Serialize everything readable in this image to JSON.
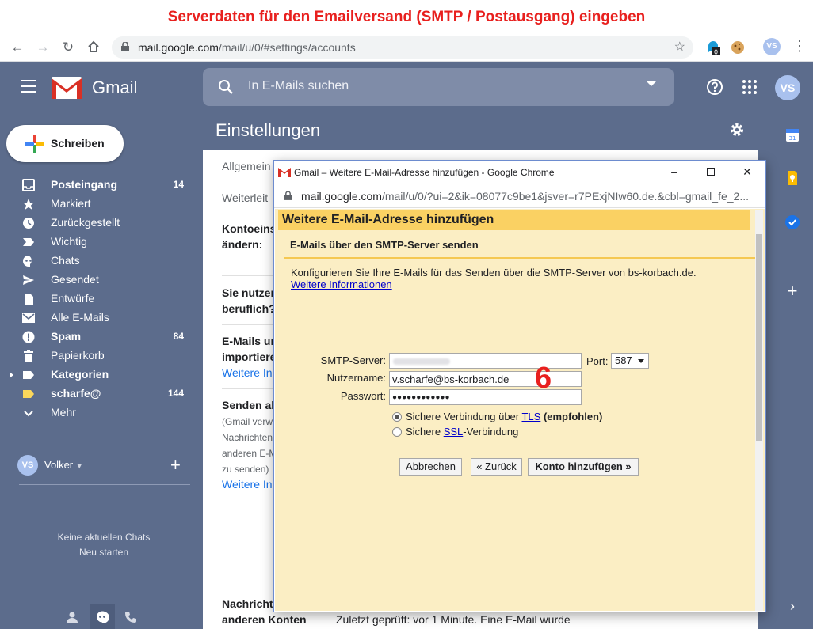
{
  "banner": {
    "text": "Serverdaten für den Emailversand (SMTP / Postausgang) eingeben"
  },
  "browser": {
    "url_host": "mail.google.com",
    "url_path": "/mail/u/0/#settings/accounts",
    "profile_initials": "VS",
    "extension_badge": "0"
  },
  "gmail": {
    "brand": "Gmail",
    "search_placeholder": "In E-Mails suchen",
    "avatar_initials": "VS",
    "compose_label": "Schreiben"
  },
  "sidebar": {
    "items": [
      {
        "label": "Posteingang",
        "count": "14",
        "bold": true,
        "icon": "inbox-icon"
      },
      {
        "label": "Markiert",
        "count": "",
        "bold": false,
        "icon": "star-icon"
      },
      {
        "label": "Zurückgestellt",
        "count": "",
        "bold": false,
        "icon": "clock-icon"
      },
      {
        "label": "Wichtig",
        "count": "",
        "bold": false,
        "icon": "important-icon"
      },
      {
        "label": "Chats",
        "count": "",
        "bold": false,
        "icon": "chat-icon"
      },
      {
        "label": "Gesendet",
        "count": "",
        "bold": false,
        "icon": "send-icon"
      },
      {
        "label": "Entwürfe",
        "count": "",
        "bold": false,
        "icon": "draft-icon"
      },
      {
        "label": "Alle E-Mails",
        "count": "",
        "bold": false,
        "icon": "mail-icon"
      },
      {
        "label": "Spam",
        "count": "84",
        "bold": true,
        "icon": "spam-icon"
      },
      {
        "label": "Papierkorb",
        "count": "",
        "bold": false,
        "icon": "trash-icon"
      },
      {
        "label": "Kategorien",
        "count": "",
        "bold": true,
        "icon": "label-icon"
      },
      {
        "label": "scharfe@",
        "count": "144",
        "bold": true,
        "icon": "label-yellow-icon"
      },
      {
        "label": "Mehr",
        "count": "",
        "bold": false,
        "icon": "chevron-down-icon"
      }
    ],
    "hangouts_user": "Volker",
    "hangouts_initials": "VS",
    "no_chats": "Keine aktuellen Chats",
    "new_chat": "Neu starten"
  },
  "settings": {
    "title": "Einstellungen",
    "tab_general": "Allgemein",
    "tab_forwarding": "Weiterleit",
    "account_change_1": "Kontoeins",
    "account_change_2": "ändern:",
    "business_1": "Sie nutzer",
    "business_2": "beruflich?",
    "import_1": "E-Mails ur",
    "import_2": "importiere",
    "more_info_1": "Weitere In",
    "send_as": "Senden als",
    "send_as_1": "(Gmail verw",
    "send_as_2": "Nachrichten",
    "send_as_3": "anderen E-M",
    "send_as_4": "zu senden)",
    "more_info_2": "Weitere In",
    "messages_1": "Nachrichte",
    "messages_2": "anderen Konten",
    "last_checked": "Zuletzt geprüft: vor 1 Minute. Eine E-Mail wurde"
  },
  "popup": {
    "window_title": "Gmail – Weitere E-Mail-Adresse hinzufügen - Google Chrome",
    "url_host": "mail.google.com",
    "url_path": "/mail/u/0/?ui=2&ik=08077c9be1&jsver=r7PExjNIw60.de.&cbl=gmail_fe_2...",
    "header": "Weitere E-Mail-Adresse hinzufügen",
    "subheader": "E-Mails über den SMTP-Server senden",
    "description": "Konfigurieren Sie Ihre E-Mails für das Senden über die SMTP-Server von bs-korbach.de.",
    "more_info_link": "Weitere Informationen",
    "smtp_label": "SMTP-Server:",
    "smtp_value": "",
    "port_label": "Port:",
    "port_value": "587",
    "username_label": "Nutzername:",
    "username_value": "v.scharfe@bs-korbach.de",
    "password_label": "Passwort:",
    "password_value": "●●●●●●●●●●●●",
    "tls_prefix": "Sichere Verbindung über ",
    "tls_link": "TLS",
    "tls_suffix": " (empfohlen)",
    "ssl_prefix": "Sichere ",
    "ssl_link": "SSL",
    "ssl_suffix": "-Verbindung",
    "btn_cancel": "Abbrechen",
    "btn_back": "« Zurück",
    "btn_add": "Konto hinzufügen »",
    "step_number": "6"
  },
  "colors": {
    "banner_text": "#e8201e",
    "gmail_theme": "#5c6c8c",
    "popup_background": "#fbeec4",
    "popup_header": "#fad163"
  }
}
